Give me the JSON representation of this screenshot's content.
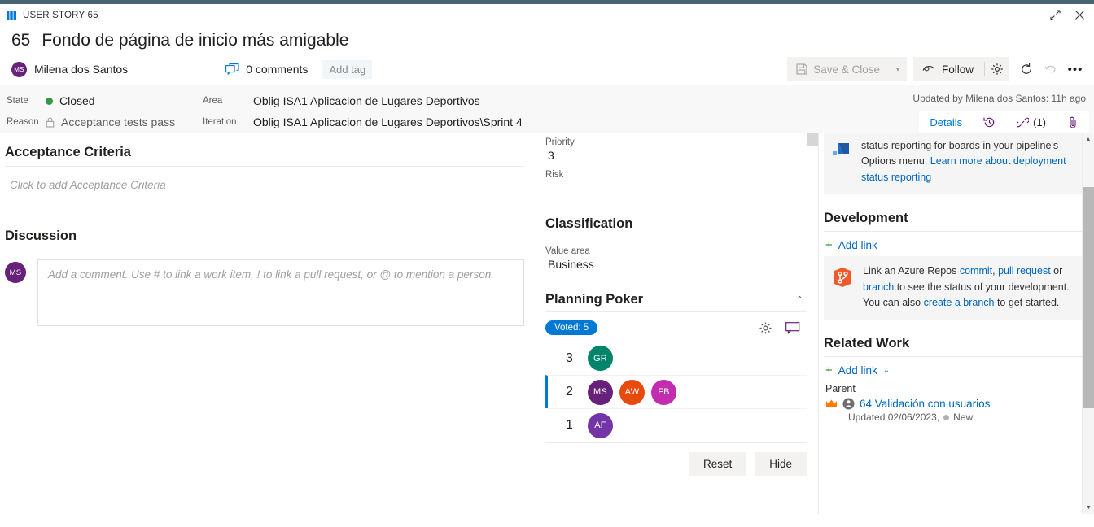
{
  "window": {
    "kicker": "USER STORY 65",
    "restore_title": "Restore",
    "close_title": "Close"
  },
  "header": {
    "id": "65",
    "title": "Fondo de página de inicio más amigable",
    "assignee": {
      "name": "Milena dos Santos",
      "initials": "MS",
      "color": "#68217a"
    },
    "comments_label": "0 comments",
    "add_tag_label": "Add tag"
  },
  "toolbar": {
    "save_close_label": "Save & Close",
    "save_dropdown_label": "▾",
    "follow_label": "Follow",
    "settings_title": "Work item settings",
    "refresh_title": "Refresh",
    "undo_title": "Undo",
    "more_title": "More actions",
    "more_label": "•••"
  },
  "fields": {
    "state_label": "State",
    "state_value": "Closed",
    "state_color": "#339947",
    "reason_label": "Reason",
    "reason_value": "Acceptance tests pass",
    "area_label": "Area",
    "area_value": "Oblig ISA1 Aplicacion de Lugares Deportivos",
    "iteration_label": "Iteration",
    "iteration_value": "Oblig ISA1 Aplicacion de Lugares Deportivos\\Sprint 4",
    "updated_by": "Updated by Milena dos Santos: 11h ago"
  },
  "detail_tabs": [
    {
      "label": "Details",
      "name": "tab-details",
      "active": true
    },
    {
      "label": "",
      "name": "tab-history",
      "icon": "history-icon",
      "active": false
    },
    {
      "label": "(1)",
      "name": "tab-links",
      "icon": "link-icon",
      "active": false
    },
    {
      "label": "",
      "name": "tab-attachments",
      "icon": "attachment-icon",
      "active": false
    }
  ],
  "left": {
    "acceptance_criteria_heading": "Acceptance Criteria",
    "acceptance_criteria_placeholder": "Click to add Acceptance Criteria",
    "discussion_heading": "Discussion",
    "comment_placeholder": "Add a comment. Use # to link a work item, ! to link a pull request, or @ to mention a person.",
    "comment_avatar": {
      "initials": "MS",
      "color": "#68217a"
    }
  },
  "middle": {
    "priority_label": "Priority",
    "priority_value": "3",
    "risk_label": "Risk",
    "risk_value": "",
    "classification_heading": "Classification",
    "value_area_label": "Value area",
    "value_area_value": "Business",
    "planning_poker_heading": "Planning Poker",
    "collapse_chevron": "⌃",
    "voted_badge": "Voted: 5",
    "settings_icon_title": "Planning Poker settings",
    "comment_icon_title": "Planning Poker comments",
    "votes": [
      {
        "value": "3",
        "selected": false,
        "voters": [
          {
            "initials": "GR",
            "color": "#00846b"
          }
        ]
      },
      {
        "value": "2",
        "selected": true,
        "voters": [
          {
            "initials": "MS",
            "color": "#68217a"
          },
          {
            "initials": "AW",
            "color": "#e8490c"
          },
          {
            "initials": "FB",
            "color": "#c42cb0"
          }
        ]
      },
      {
        "value": "1",
        "selected": false,
        "voters": [
          {
            "initials": "AF",
            "color": "#7334a8"
          }
        ]
      }
    ],
    "reset_label": "Reset",
    "hide_label": "Hide"
  },
  "right": {
    "deployment_note": {
      "line1_clipped": "status reporting for boards in your pipeline's",
      "line2_prefix": "Options menu. ",
      "line2_link": "Learn more about deployment status reporting"
    },
    "development_heading": "Development",
    "development_add_link": "Add link",
    "development_note": {
      "p1": "Link an Azure Repos ",
      "link_commit": "commit",
      "sep1": ", ",
      "link_pr": "pull request",
      "p2": " or ",
      "link_branch": "branch",
      "p3": " to see the status of your development. You can also ",
      "link_create_branch": "create a branch",
      "p4": " to get started."
    },
    "related_work_heading": "Related Work",
    "related_add_link": "Add link",
    "related_add_chevron": "⌄",
    "parent_group_label": "Parent",
    "parent_item": {
      "id_and_title": "64 Validación con usuarios",
      "updated": "Updated 02/06/2023,",
      "state": "New"
    }
  }
}
